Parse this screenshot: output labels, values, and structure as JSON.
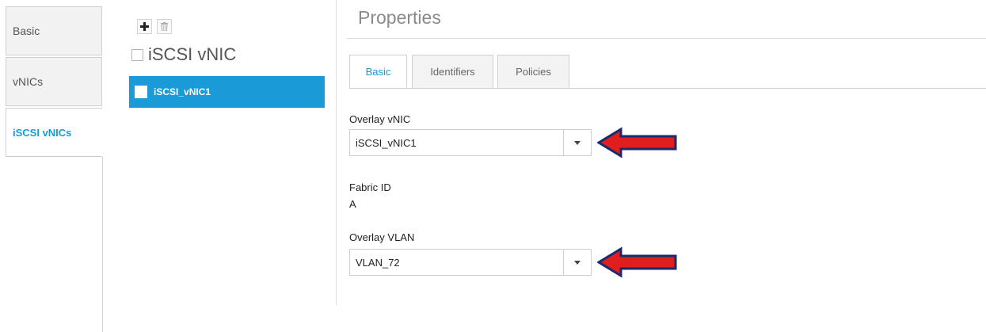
{
  "left_tabs": [
    {
      "label": "Basic"
    },
    {
      "label": "vNICs"
    },
    {
      "label": "iSCSI vNICs"
    }
  ],
  "list": {
    "header_title": "iSCSI vNIC",
    "rows": [
      {
        "label": "iSCSI_vNIC1"
      }
    ]
  },
  "properties": {
    "title": "Properties",
    "tabs": [
      {
        "label": "Basic"
      },
      {
        "label": "Identifiers"
      },
      {
        "label": "Policies"
      }
    ],
    "overlay_vnic": {
      "label": "Overlay vNIC",
      "value": "iSCSI_vNIC1"
    },
    "fabric_id": {
      "label": "Fabric ID",
      "value": "A"
    },
    "overlay_vlan": {
      "label": "Overlay VLAN",
      "value": "VLAN_72"
    }
  },
  "colors": {
    "accent": "#1a9bd7",
    "arrow_fill": "#e01e1e",
    "arrow_outline": "#1a2a6c"
  },
  "icons": [
    "add-icon",
    "delete-icon",
    "chevron-down-icon",
    "arrow-left-icon"
  ]
}
